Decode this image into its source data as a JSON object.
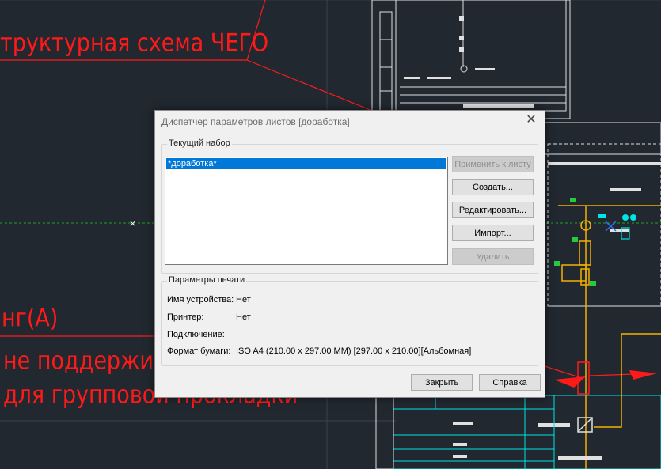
{
  "background_texts": {
    "t1": "труктурная схема ЧЕГО",
    "t2": "нг(А)",
    "t3": "не поддерживаю",
    "t4": "для групповой прокладки"
  },
  "dialog": {
    "title": "Диспетчер параметров листов [доработка]",
    "current_set_label": "Текущий набор",
    "list_items": [
      "*доработка*"
    ],
    "buttons": {
      "apply": "Применить к листу",
      "create": "Создать...",
      "edit": "Редактировать...",
      "import": "Импорт...",
      "delete": "Удалить"
    },
    "print_params_label": "Параметры печати",
    "params": {
      "device_label": "Имя устройства:",
      "device_value": "Нет",
      "printer_label": "Принтер:",
      "printer_value": "Нет",
      "connection_label": "Подключение:",
      "connection_value": "",
      "paper_label": "Формат бумаги:",
      "paper_value": "ISO A4 (210.00 x 297.00 MM) [297.00 x 210.00][Альбомная]"
    },
    "close_label": "Закрыть",
    "help_label": "Справка"
  },
  "colors": {
    "cad_background": "#212830",
    "red": "#ff1a1a",
    "cyan": "#00e5e5",
    "yellow": "#f5b000",
    "green": "#27c93f",
    "selection": "#0078d7"
  }
}
